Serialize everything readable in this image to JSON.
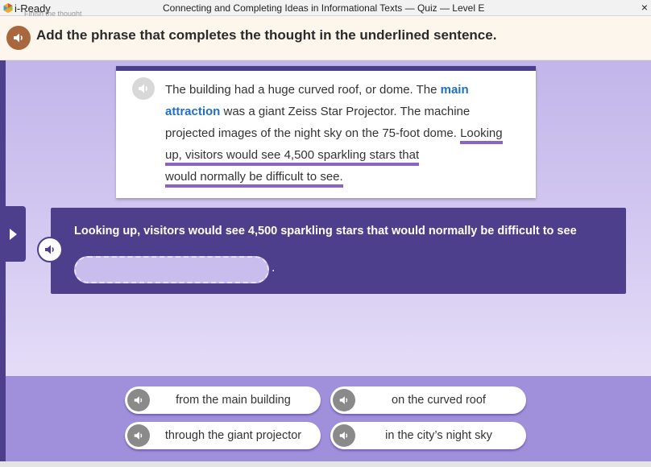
{
  "app": {
    "logo_text": "i-Ready",
    "ghost_text": "Finish the thought",
    "window_title": "Connecting and Completing Ideas in Informational Texts — Quiz — Level E",
    "close_glyph": "×"
  },
  "prompt": {
    "text": "Add the phrase that completes the thought in the underlined sentence.",
    "icon": "speaker-icon"
  },
  "passage": {
    "intro": "The building had a huge curved roof, or dome. The ",
    "keyword": "main attraction",
    "middle": " was a giant Zeiss Star Projector. The machine projected images of the night sky on the 75-foot dome. ",
    "underlined_1": "Looking up, visitors would see 4,500 sparkling stars that",
    "underlined_2": "would normally be difficult to see."
  },
  "question": {
    "sentence": "Looking up, visitors would see 4,500 sparkling stars that would normally be difficult to see",
    "period": "."
  },
  "answers": [
    {
      "label": "from the main building"
    },
    {
      "label": "on the curved roof"
    },
    {
      "label": "through the giant projector"
    },
    {
      "label": "in the city’s night sky"
    }
  ],
  "colors": {
    "accent_purple": "#4e3f8d",
    "keyword_blue": "#1e6fc9",
    "speaker_brown": "#a9673e",
    "underline_purple": "#8a63c5"
  }
}
